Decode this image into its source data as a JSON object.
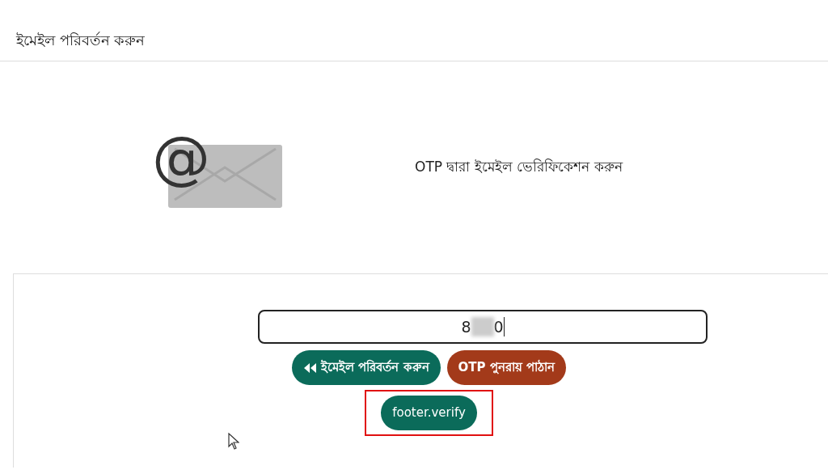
{
  "header": {
    "title": "ইমেইল পরিবর্তন করুন"
  },
  "intro": {
    "icon_glyph": "@",
    "message": "OTP দ্বারা ইমেইল ভেরিফিকেশন করুন"
  },
  "otp_field": {
    "visible_start": "8",
    "visible_end": "0",
    "redacted": true
  },
  "buttons": [
    {
      "kind": "back",
      "label": "ইমেইল পরিবর্তন করুন",
      "color": "#0b6b5a"
    },
    {
      "kind": "resend",
      "label": "OTP পুনরায় পাঠান",
      "color": "#a33a1a"
    }
  ],
  "verify_button": {
    "label": "footer.verify",
    "highlighted": true
  }
}
